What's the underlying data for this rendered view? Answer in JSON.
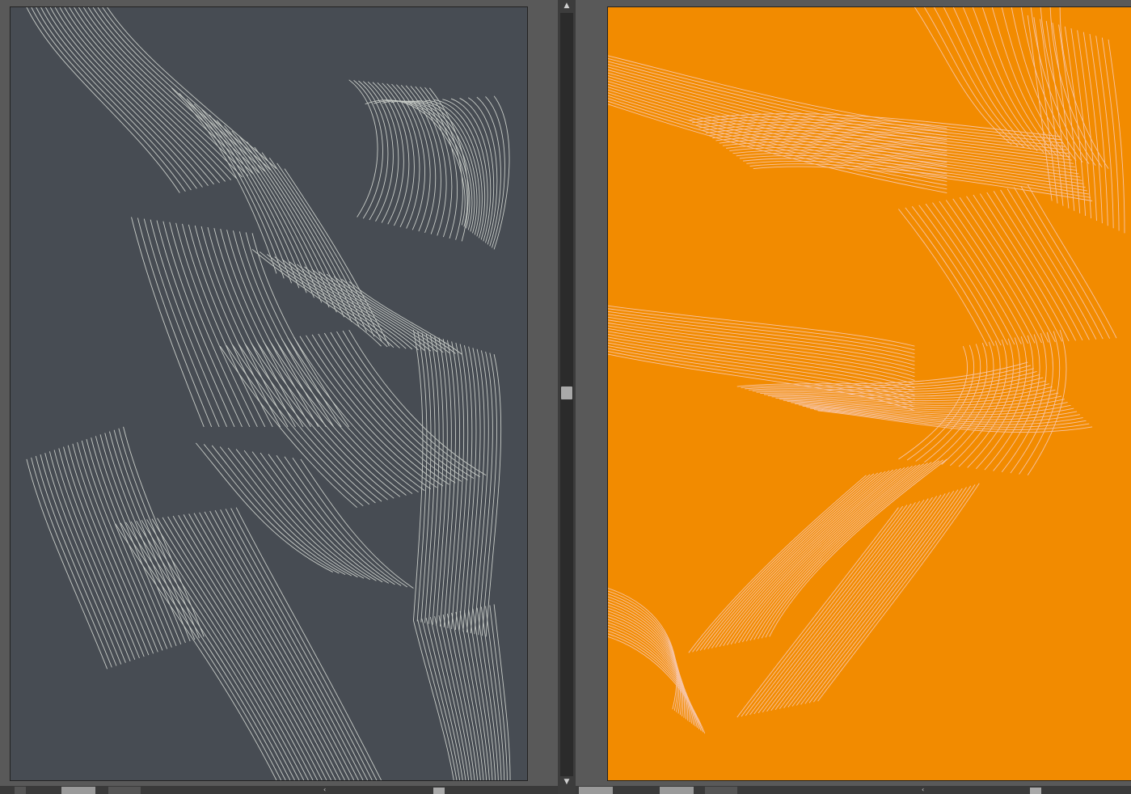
{
  "windows": [
    {
      "artboard_color": "#474c53",
      "line_color": "#c9cdc8",
      "illustration": "muscular-figure-line-art-gray",
      "status": {
        "zoom": "",
        "doc_label": "",
        "icons": [
          "chevron-left-icon"
        ]
      }
    },
    {
      "artboard_color": "#f28b00",
      "line_color": "#f7c4a4",
      "illustration": "muscular-figure-line-art-orange",
      "status": {
        "zoom": "",
        "doc_label": "",
        "icons": [
          "chevron-left-icon"
        ]
      }
    }
  ],
  "scrollbar": {
    "icons": [
      "arrow-up-icon",
      "arrow-down-icon"
    ],
    "position": 0.5
  }
}
